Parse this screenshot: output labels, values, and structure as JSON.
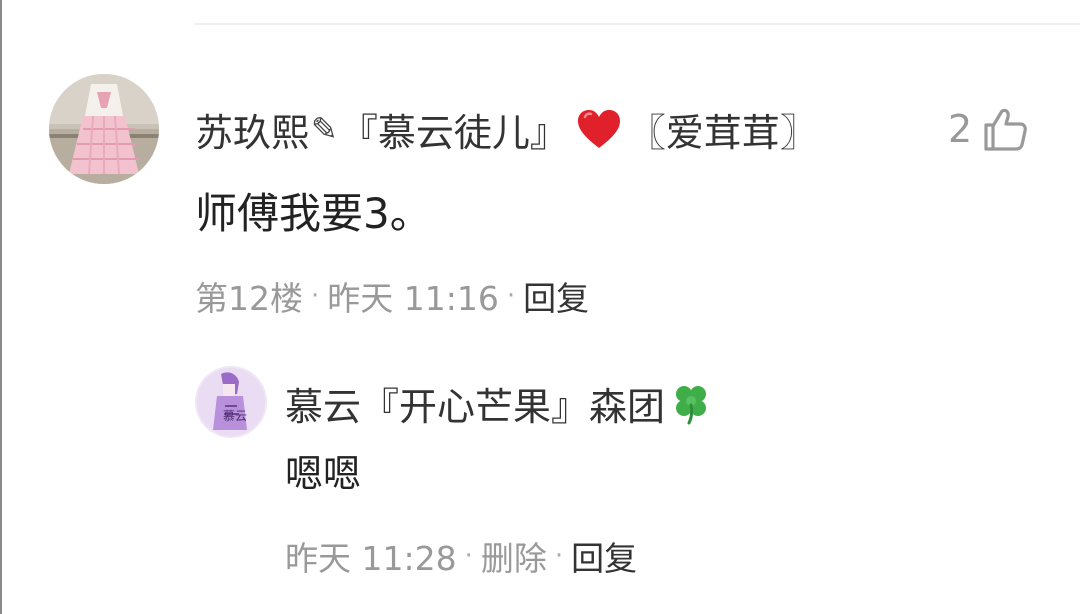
{
  "comment": {
    "username": {
      "part1": "苏玖熙",
      "pencil": "✎",
      "part2": "『慕云徒儿』",
      "part3": "〖爱茸茸〗"
    },
    "like_count": "2",
    "text": "师傅我要3。",
    "meta": {
      "floor": "第12楼",
      "time": "昨天 11:16",
      "reply": "回复",
      "separator": "·"
    }
  },
  "reply": {
    "username": "慕云『开心芒果』森团",
    "text": "嗯嗯",
    "meta": {
      "time": "昨天 11:28",
      "delete": "删除",
      "reply": "回复",
      "separator": "·"
    }
  },
  "icons": {
    "heart": "heart-icon",
    "clover": "four-leaf-clover-icon",
    "thumb": "thumbs-up-icon"
  },
  "colors": {
    "heart": "#e0202a",
    "clover": "#3fae49",
    "meta_gray": "#999999",
    "text": "#222222"
  }
}
